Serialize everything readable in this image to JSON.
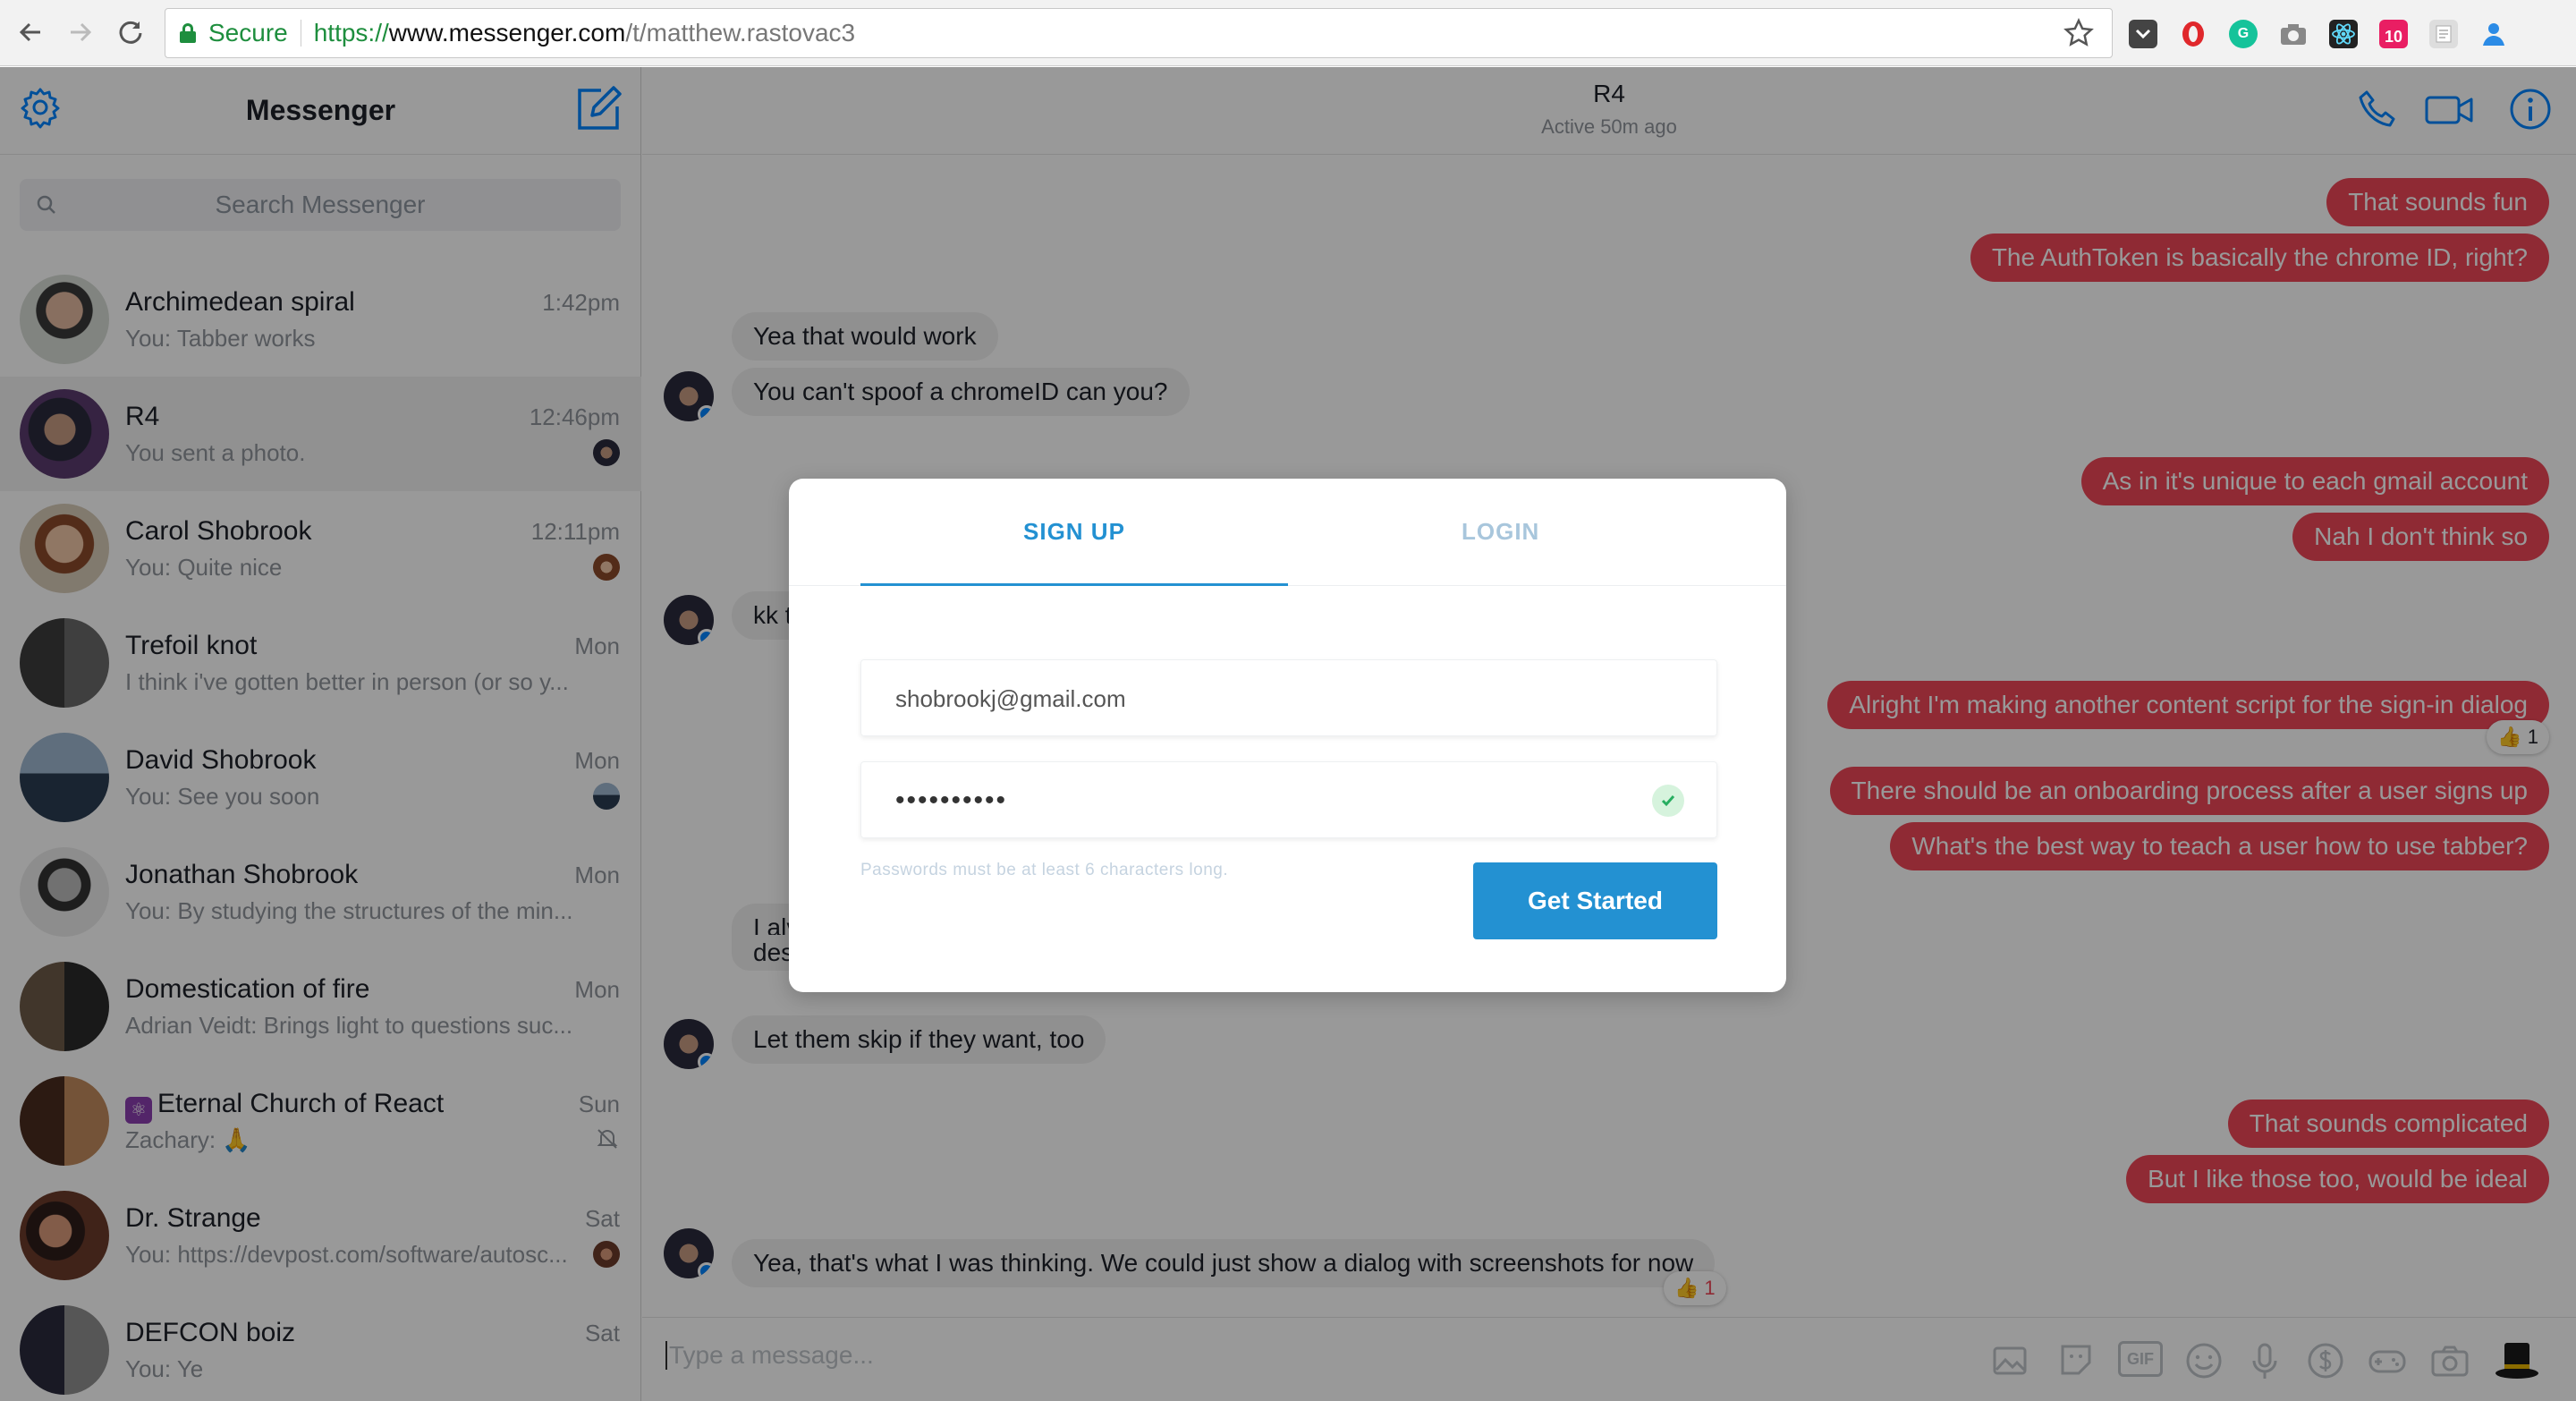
{
  "browser": {
    "secure_label": "Secure",
    "url_scheme": "https://",
    "url_host": "www.messenger.com",
    "url_path": "/t/matthew.rastovac3",
    "extensions": [
      "pocket-icon",
      "opera-icon",
      "grammarly-icon",
      "camera-icon",
      "react-devtools-icon",
      "calendar-icon",
      "reader-icon",
      "person-icon"
    ],
    "calendar_badge": "10"
  },
  "sidebar": {
    "title": "Messenger",
    "search_placeholder": "Search Messenger",
    "conversations": [
      {
        "name": "Archimedean spiral",
        "time": "1:42pm",
        "snippet": "You: Tabber works"
      },
      {
        "name": "R4",
        "time": "12:46pm",
        "snippet": "You sent a photo."
      },
      {
        "name": "Carol Shobrook",
        "time": "12:11pm",
        "snippet": "You: Quite nice"
      },
      {
        "name": "Trefoil knot",
        "time": "Mon",
        "snippet": "I think i've gotten better in person (or so y..."
      },
      {
        "name": "David Shobrook",
        "time": "Mon",
        "snippet": "You: See you soon"
      },
      {
        "name": "Jonathan Shobrook",
        "time": "Mon",
        "snippet": "You: By studying the structures of the min..."
      },
      {
        "name": "Domestication of fire",
        "time": "Mon",
        "snippet": "Adrian Veidt: Brings light to questions suc..."
      },
      {
        "name": "Eternal Church of React",
        "time": "Sun",
        "snippet": "Zachary: 🙏"
      },
      {
        "name": "Dr. Strange",
        "time": "Sat",
        "snippet": "You: https://devpost.com/software/autosc..."
      },
      {
        "name": "DEFCON boiz",
        "time": "Sat",
        "snippet": "You: Ye"
      }
    ]
  },
  "conversation": {
    "title": "R4",
    "status": "Active 50m ago",
    "messages": [
      {
        "dir": "out",
        "text": "That sounds fun"
      },
      {
        "dir": "out",
        "text": "The AuthToken is basically the chrome ID, right?"
      },
      {
        "dir": "in",
        "text": "Yea that would work"
      },
      {
        "dir": "in",
        "text": "You can't spoof a chromeID can you?"
      },
      {
        "dir": "out",
        "text": "As in it's unique to each gmail account"
      },
      {
        "dir": "out",
        "text": "Nah I don't think so"
      },
      {
        "dir": "in",
        "text": "kk t"
      },
      {
        "dir": "out",
        "text": "Alright I'm making another content script for the sign-in dialog"
      },
      {
        "dir": "out",
        "text": "There should be an onboarding process after a user signs up"
      },
      {
        "dir": "out",
        "text": "What's the best way to teach a user how to use tabber?"
      },
      {
        "dir": "in",
        "text": "I alv"
      },
      {
        "dir": "in",
        "text": "des"
      },
      {
        "dir": "in",
        "text": "Let them skip if they want, too"
      },
      {
        "dir": "out",
        "text": "That sounds complicated"
      },
      {
        "dir": "out",
        "text": "But I like those too, would be ideal"
      },
      {
        "dir": "in",
        "text": "Yea, that's what I was thinking. We could just show a dialog with screenshots for now"
      }
    ],
    "reactions": [
      {
        "count": "1"
      },
      {
        "count": "1"
      }
    ],
    "composer_placeholder": "Type a message...",
    "gif_label": "GIF",
    "accent": "#ef4758"
  },
  "modal": {
    "tab_signup": "SIGN UP",
    "tab_login": "LOGIN",
    "email_value": "shobrookj@gmail.com",
    "password_value": "••••••••••",
    "hint": "Passwords must be at least 6 characters long.",
    "cta": "Get Started",
    "accent": "#2391d2"
  }
}
